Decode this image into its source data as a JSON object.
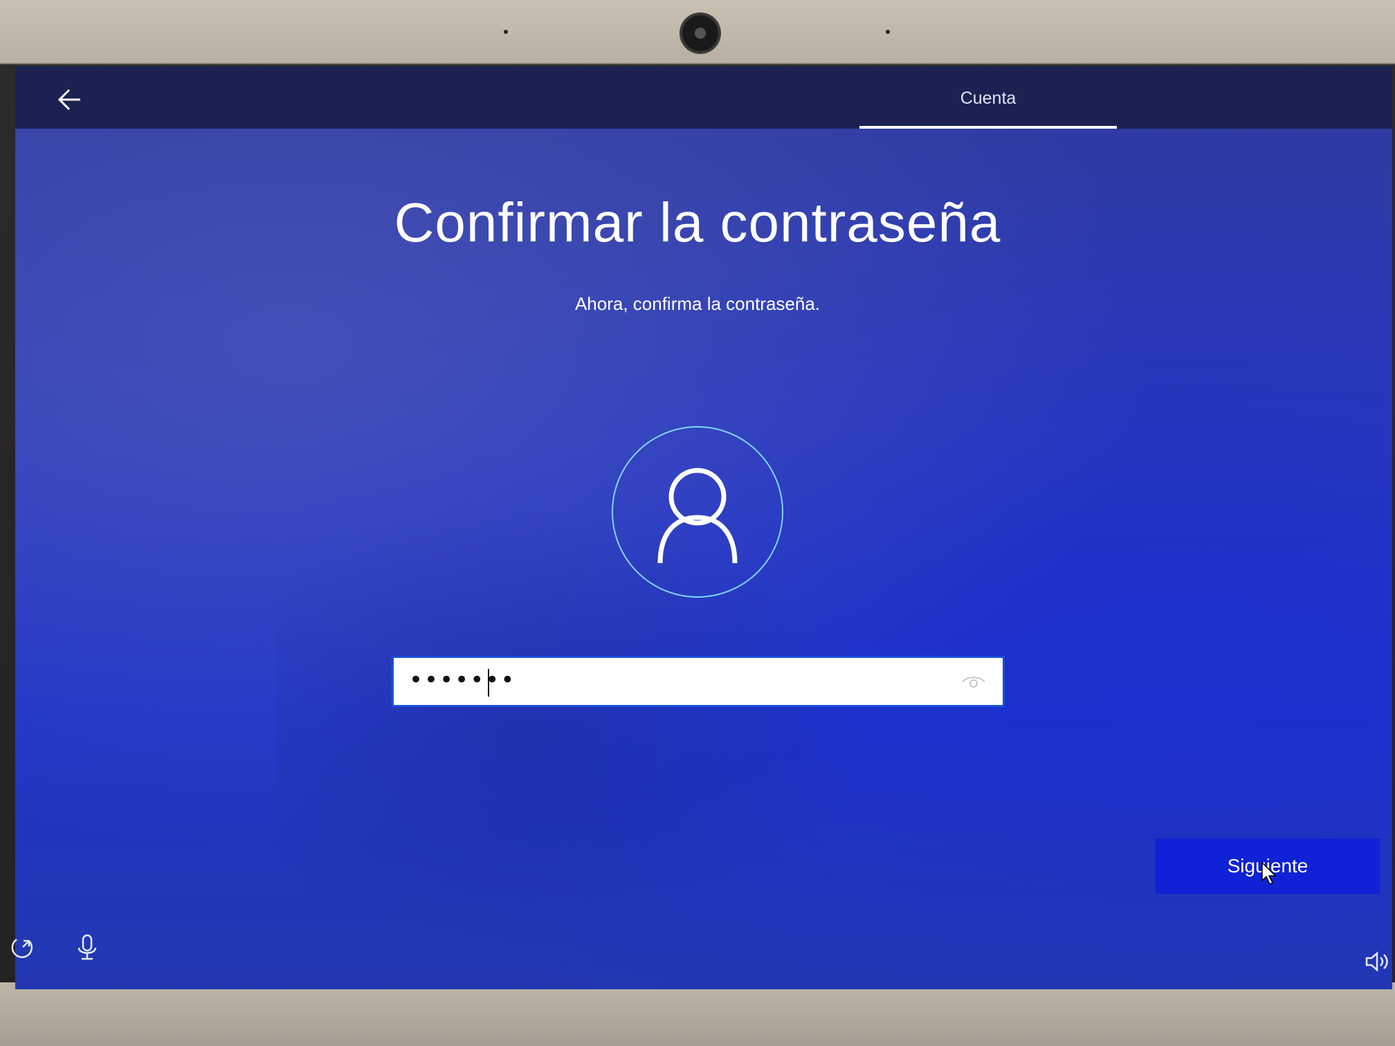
{
  "header": {
    "back_icon": "arrow-left-icon",
    "tab_label": "Cuenta"
  },
  "main": {
    "title": "Confirmar la contraseña",
    "subtitle": "Ahora, confirma la contraseña.",
    "avatar_icon": "user-icon",
    "password_field": {
      "masked_value": "•••••••",
      "reveal_icon": "eye-icon"
    },
    "next_button": "Siguiente"
  },
  "footer": {
    "left_icons": [
      "ease-of-access-icon",
      "microphone-icon"
    ],
    "right_icon": "volume-icon"
  },
  "colors": {
    "background": "#2d3cb8",
    "topbar": "#1c2152",
    "accent_button": "#0f22d6",
    "avatar_ring": "#7fd6ff"
  }
}
